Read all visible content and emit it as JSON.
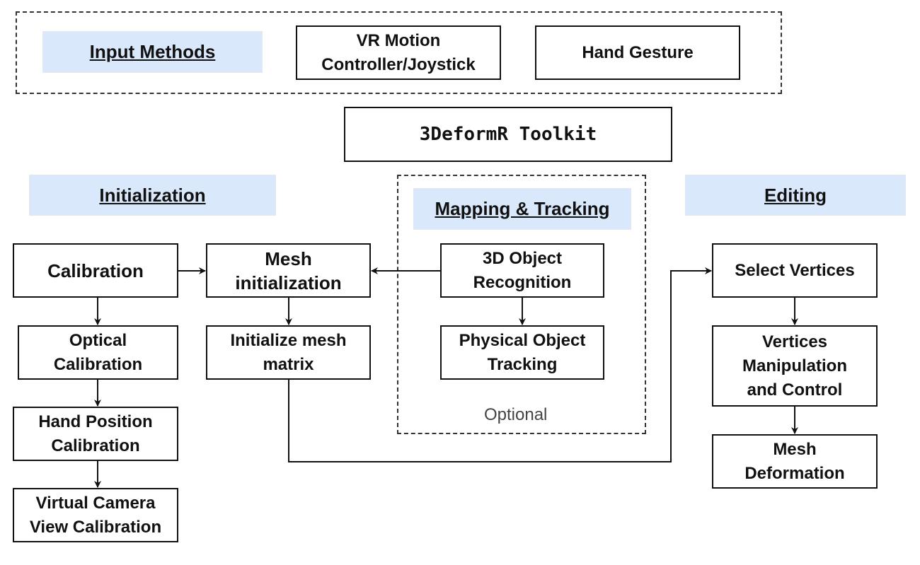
{
  "colors": {
    "section_label_bg": "#dae8fc",
    "stroke": "#111111"
  },
  "input_methods": {
    "label": "Input Methods",
    "items": [
      "VR Motion\nController/Joystick",
      "Hand Gesture"
    ]
  },
  "toolkit": {
    "title": "3DeformR Toolkit"
  },
  "initialization": {
    "label": "Initialization",
    "calibration": [
      "Calibration",
      "Optical\nCalibration",
      "Hand Position\nCalibration",
      "Virtual Camera\nView Calibration"
    ],
    "mesh": [
      "Mesh\ninitialization",
      "Initialize mesh\nmatrix"
    ]
  },
  "mapping": {
    "label": "Mapping & Tracking",
    "items": [
      "3D Object\nRecognition",
      "Physical Object\nTracking"
    ],
    "note": "Optional"
  },
  "editing": {
    "label": "Editing",
    "items": [
      "Select Vertices",
      "Vertices\nManipulation\nand Control",
      "Mesh\nDeformation"
    ]
  }
}
